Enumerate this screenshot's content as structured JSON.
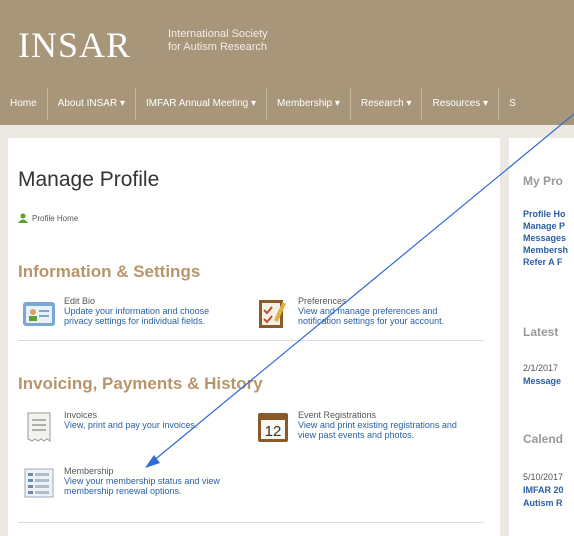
{
  "header": {
    "logo": "INSAR",
    "subtitle_line1": "International Society",
    "subtitle_line2": "for Autism Research",
    "nav": [
      "Home",
      "About INSAR ▾",
      "IMFAR Annual Meeting ▾",
      "Membership ▾",
      "Research ▾",
      "Resources ▾",
      "S"
    ]
  },
  "main": {
    "title": "Manage Profile",
    "breadcrumb": "Profile Home",
    "sections": [
      {
        "heading": "Information & Settings",
        "items": [
          {
            "icon": "id-card-icon",
            "title": "Edit Bio",
            "desc": "Update your information and choose privacy settings for individual fields."
          },
          {
            "icon": "checklist-pencil-icon",
            "title": "Preferences",
            "desc": "View and manage preferences and notification settings for your account."
          }
        ]
      },
      {
        "heading": "Invoicing, Payments & History",
        "items": [
          {
            "icon": "receipt-icon",
            "title": "Invoices",
            "desc": "View, print and pay your invoices."
          },
          {
            "icon": "calendar-icon",
            "title": "Event Registrations",
            "desc": "View and print existing registrations and view past events and photos.",
            "calendar_day": "12"
          },
          {
            "icon": "membership-list-icon",
            "title": "Membership",
            "desc": "View your membership status and view membership renewal options."
          }
        ]
      }
    ]
  },
  "sidebar": {
    "heading": "My Pro",
    "links": [
      "Profile Ho",
      "Manage P",
      "Messages",
      "Membersh",
      "Refer A F"
    ],
    "latest_heading": "Latest",
    "latest_date": "2/1/2017",
    "latest_item": "Message",
    "calendar_heading": "Calend",
    "calendar_date": "5/10/2017",
    "calendar_item1": "IMFAR 20",
    "calendar_item2": "Autism R"
  },
  "colors": {
    "header": "#a8967a",
    "section_heading": "#b8956a",
    "link": "#2a5fa6",
    "arrow": "#2e6bd6"
  }
}
